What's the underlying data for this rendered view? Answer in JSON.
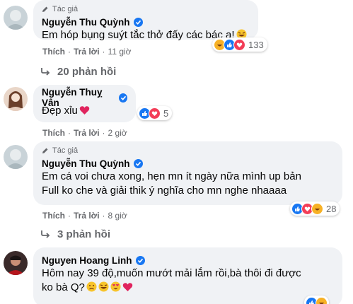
{
  "comments": [
    {
      "author_tag": "Tác giả",
      "author": "Nguyễn Thu Quỳnh",
      "verified": true,
      "text": "Em hóp bụng suýt tắc thở đấy các bác ạ!",
      "text_emoji": "rolling-laugh-emoji",
      "actions": {
        "like": "Thích",
        "reply": "Trả lời",
        "time": "11 giờ"
      },
      "reactions": {
        "icons": [
          "haha-icon",
          "like-icon",
          "love-icon"
        ],
        "count": "133"
      },
      "replies": "20 phản hồi"
    },
    {
      "author": "Nguyễn Thuỵ Vân",
      "verified": true,
      "text": "Đẹp xỉu",
      "text_emoji": "red-heart-emoji",
      "actions": {
        "like": "Thích",
        "reply": "Trả lời",
        "time": "2 giờ"
      },
      "reactions": {
        "icons": [
          "like-icon",
          "love-icon"
        ],
        "count": "5"
      }
    },
    {
      "author_tag": "Tác giả",
      "author": "Nguyễn Thu Quỳnh",
      "verified": true,
      "text": "Em cá voi chưa xong, hẹn mn ít ngày nữa mình up bản\nFull ko che và giải thik ý nghĩa cho mn nghe nhaaaa",
      "actions": {
        "like": "Thích",
        "reply": "Trả lời",
        "time": "8 giờ"
      },
      "reactions": {
        "icons": [
          "like-icon",
          "love-icon",
          "haha-icon"
        ],
        "count": "28"
      },
      "replies": "3 phản hồi"
    },
    {
      "author": "Nguyen Hoang Linh",
      "verified": true,
      "text": "Hôm nay 39 độ,muốn mướt mải lắm rồi,bà thôi đi được\nko bà Q?",
      "text_emojis": [
        "sad-emoji",
        "rolling-laugh-emoji",
        "heart-eyes-emoji",
        "red-heart-emoji"
      ]
    }
  ],
  "colors": {
    "bubble": "#f0f2f5",
    "secondary_text": "#65676b",
    "verified": "#1877f2",
    "like": "#1877f2",
    "love": "#f33e58",
    "haha": "#f7b125"
  }
}
